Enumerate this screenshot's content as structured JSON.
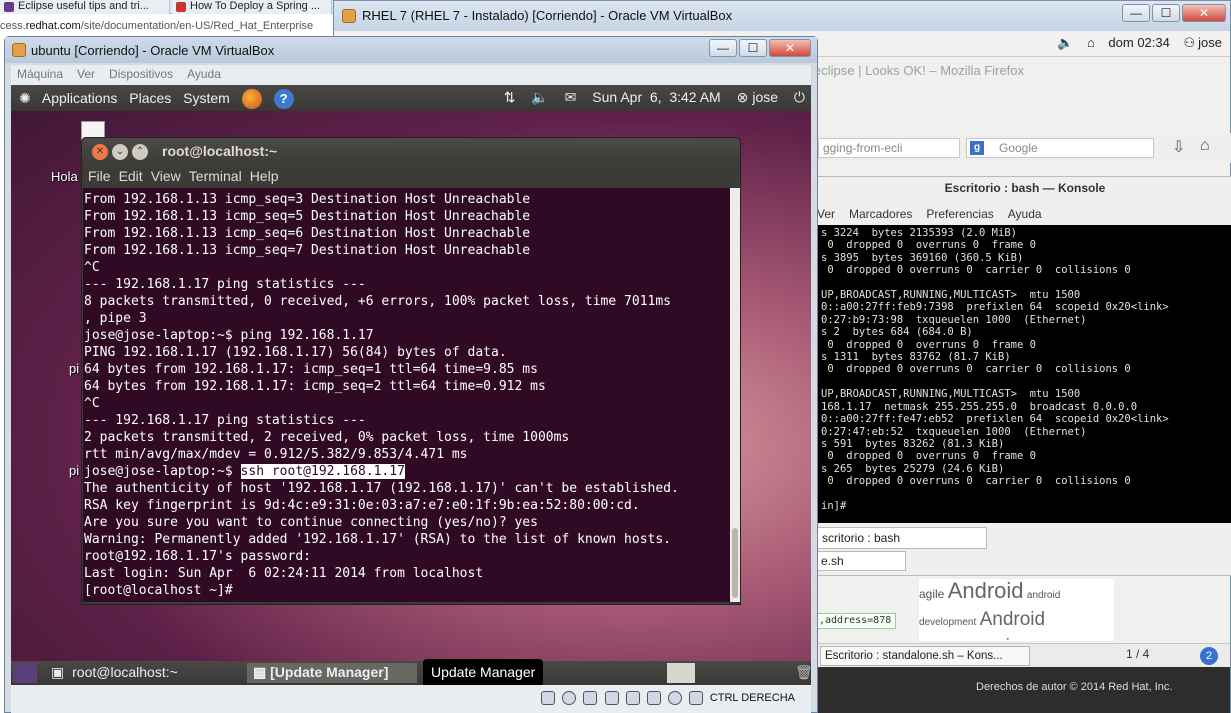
{
  "browser": {
    "tabs": [
      "Eclipse useful tips and tri...",
      "How To Deploy a Spring ..."
    ],
    "url_prefix": "cess.",
    "url_host": "redhat.com",
    "url_path": "/site/documentation/en-US/Red_Hat_Enterprise"
  },
  "rhel_window": {
    "title": "RHEL 7 (RHEL 7 - Instalado) [Corriendo] - Oracle VM VirtualBox",
    "buttons": {
      "minimize": "—",
      "maximize": "☐",
      "close": "✕"
    },
    "panel": {
      "clock": "dom 02:34",
      "user": "jose"
    },
    "firefox_title": "eclipse | Looks OK! – Mozilla Firefox",
    "firefox_url_fragment": "gging-from-ecli",
    "firefox_search_placeholder": "Google",
    "konsole": {
      "title": "Escritorio : bash — Konsole",
      "menu": [
        "Ver",
        "Marcadores",
        "Preferencias",
        "Ayuda"
      ],
      "lines": [
        "s 3224  bytes 2135393 (2.0 MiB)",
        " 0  dropped 0  overruns 0  frame 0",
        "s 3895  bytes 369160 (360.5 KiB)",
        " 0  dropped 0 overruns 0  carrier 0  collisions 0",
        "",
        "UP,BROADCAST,RUNNING,MULTICAST>  mtu 1500",
        "0::a00:27ff:feb9:7398  prefixlen 64  scopeid 0x20<link>",
        "0:27:b9:73:98  txqueuelen 1000  (Ethernet)",
        "s 2  bytes 684 (684.0 B)",
        " 0  dropped 0  overruns 0  frame 0",
        "s 1311  bytes 83762 (81.7 KiB)",
        " 0  dropped 0 overruns 0  carrier 0  collisions 0",
        "",
        "UP,BROADCAST,RUNNING,MULTICAST>  mtu 1500",
        "168.1.17  netmask 255.255.255.0  broadcast 0.0.0.0",
        "0::a00:27ff:fe47:eb52  prefixlen 64  scopeid 0x20<link>",
        "0:27:47:eb:52  txqueuelen 1000  (Ethernet)",
        "s 591  bytes 83262 (81.3 KiB)",
        " 0  dropped 0  overruns 0  frame 0",
        "s 265  bytes 25279 (24.6 KiB)",
        " 0  dropped 0 overruns 0  carrier 0  collisions 0",
        "",
        "in]# "
      ],
      "tab": "scritorio : bash"
    },
    "file_tab": "e.sh",
    "tagcloud": [
      "agile",
      "Android",
      "android",
      "development",
      "Android",
      "programming"
    ],
    "code_snippet": ",address=878",
    "taskbar_item": "Escritorio : standalone.sh – Kons...",
    "workspace": "1 / 4",
    "help": "2",
    "copyright": "Derechos de autor © 2014 Red Hat, Inc."
  },
  "ubuntu_window": {
    "title": "ubuntu [Corriendo] - Oracle VM VirtualBox",
    "buttons": {
      "minimize": "—",
      "maximize": "☐",
      "close": "✕"
    },
    "menubar": [
      "Máquina",
      "Ver",
      "Dispositivos",
      "Ayuda"
    ],
    "gnome_panel": {
      "menus": [
        "Applications",
        "Places",
        "System"
      ],
      "datetime": "Sun Apr  6,  3:42 AM",
      "user": "jose"
    },
    "desktop_labels": [
      "Hola",
      "pi",
      "pi"
    ],
    "terminal": {
      "title": "root@localhost:~",
      "menu": [
        "File",
        "Edit",
        "View",
        "Terminal",
        "Help"
      ],
      "lines": [
        "From 192.168.1.13 icmp_seq=3 Destination Host Unreachable",
        "From 192.168.1.13 icmp_seq=5 Destination Host Unreachable",
        "From 192.168.1.13 icmp_seq=6 Destination Host Unreachable",
        "From 192.168.1.13 icmp_seq=7 Destination Host Unreachable",
        "^C",
        "--- 192.168.1.17 ping statistics ---",
        "8 packets transmitted, 0 received, +6 errors, 100% packet loss, time 7011ms",
        ", pipe 3",
        "jose@jose-laptop:~$ ping 192.168.1.17",
        "PING 192.168.1.17 (192.168.1.17) 56(84) bytes of data.",
        "64 bytes from 192.168.1.17: icmp_seq=1 ttl=64 time=9.85 ms",
        "64 bytes from 192.168.1.17: icmp_seq=2 ttl=64 time=0.912 ms",
        "^C",
        "--- 192.168.1.17 ping statistics ---",
        "2 packets transmitted, 2 received, 0% packet loss, time 1000ms",
        "rtt min/avg/max/mdev = 0.912/5.382/9.853/4.471 ms"
      ],
      "prompt": "jose@jose-laptop:~$ ",
      "highlighted_cmd": "ssh root@192.168.1.17",
      "lines_after": [
        "The authenticity of host '192.168.1.17 (192.168.1.17)' can't be established.",
        "RSA key fingerprint is 9d:4c:e9:31:0e:03:a7:e7:e0:1f:9b:ea:52:80:00:cd.",
        "Are you sure you want to continue connecting (yes/no)? yes",
        "Warning: Permanently added '192.168.1.17' (RSA) to the list of known hosts.",
        "root@192.168.1.17's password:",
        "Last login: Sun Apr  6 02:24:11 2014 from localhost",
        "[root@localhost ~]# "
      ]
    },
    "bottom_panel": {
      "task1": "root@localhost:~",
      "task2": "[Update Manager]",
      "tooltip": "Update Manager"
    },
    "status_label": "CTRL DERECHA"
  }
}
